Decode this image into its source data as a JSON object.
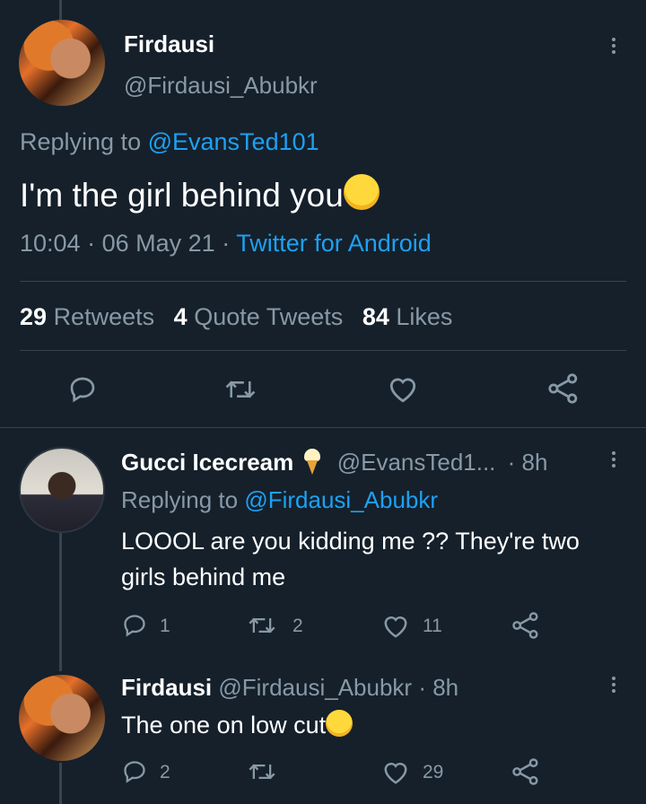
{
  "main_tweet": {
    "display_name": "Firdausi",
    "handle": "@Firdausi_Abubkr",
    "replying_prefix": "Replying to",
    "replying_handle": "@EvansTed101",
    "text": "I'm the girl behind you",
    "emoji": "face-with-tears-of-joy",
    "time": "10:04",
    "date": "06 May 21",
    "source": "Twitter for Android",
    "stats": {
      "retweets_count": "29",
      "retweets_label": "Retweets",
      "quotes_count": "4",
      "quotes_label": "Quote Tweets",
      "likes_count": "84",
      "likes_label": "Likes"
    }
  },
  "replies": [
    {
      "display_name": "Gucci Icecream",
      "name_emoji": "ice-cream-icon",
      "handle": "@EvansTed1...",
      "time": "· 8h",
      "replying_prefix": "Replying to",
      "replying_handle": "@Firdausi_Abubkr",
      "text_line1": "LOOOL are you kidding me ?? They're two",
      "text_line2": "girls behind me",
      "reply_count": "1",
      "retweet_count": "2",
      "like_count": "11"
    },
    {
      "display_name": "Firdausi",
      "handle": "@Firdausi_Abubkr",
      "time": "· 8h",
      "text": "The one on low cut",
      "emoji": "face-with-tears-of-joy",
      "reply_count": "2",
      "retweet_count": "",
      "like_count": "29"
    }
  ],
  "colors": {
    "background": "#15202b",
    "link": "#1da1f2",
    "muted": "#8899a6",
    "divider": "#38444d"
  }
}
